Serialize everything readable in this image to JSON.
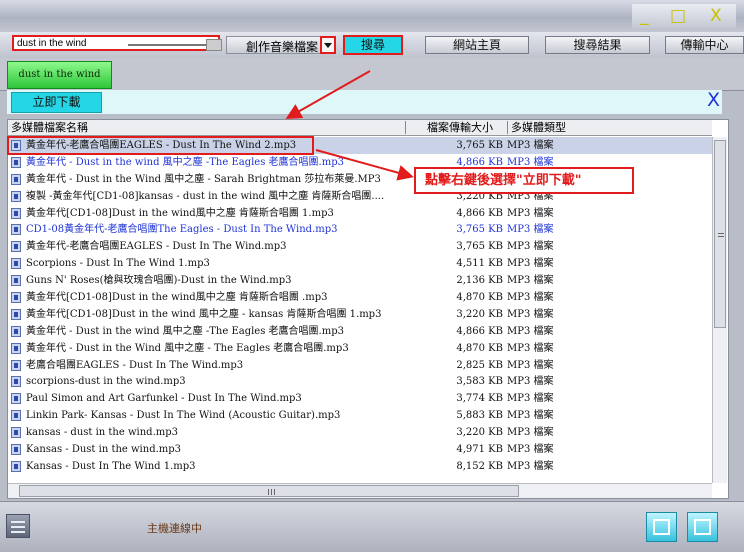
{
  "window": {
    "buttons": [
      "_",
      "□",
      "X"
    ]
  },
  "toolbar": {
    "search_value": "dust in the wind",
    "category": "創作音樂檔案",
    "search_label": "搜尋",
    "home_label": "網站主頁",
    "results_label": "搜尋結果",
    "transfer_label": "傳輸中心"
  },
  "tab_label": "dust in the wind",
  "download_label": "立即下載",
  "close_label": "X",
  "columns": {
    "name": "多媒體檔案名稱",
    "size": "檔案傳輸大小",
    "type": "多媒體類型"
  },
  "rows": [
    {
      "name": "黃金年代-老鷹合唱團EAGLES - Dust In The Wind 2.mp3",
      "size": "3,765 KB",
      "type": "MP3 檔案",
      "selected": true
    },
    {
      "name": "黃金年代 - Dust in the wind 風中之塵 -The Eagles 老鷹合唱團.mp3",
      "size": "4,866 KB",
      "type": "MP3 檔案",
      "blue": true
    },
    {
      "name": "黃金年代 - Dust in the Wind 風中之塵 - Sarah Brightman 莎拉布萊曼.MP3",
      "size": "4,868 KB",
      "type": "MP3 檔案"
    },
    {
      "name": "複製 -黃金年代[CD1-08]kansas - dust in the wind 風中之塵 肯薩斯合唱團....",
      "size": "3,220 KB",
      "type": "MP3 檔案"
    },
    {
      "name": "黃金年代[CD1-08]Dust in the wind風中之塵 肯薩斯合唱團 1.mp3",
      "size": "4,866 KB",
      "type": "MP3 檔案"
    },
    {
      "name": "CD1-08黃金年代-老鷹合唱團The Eagles - Dust In The Wind.mp3",
      "size": "3,765 KB",
      "type": "MP3 檔案",
      "blue": true
    },
    {
      "name": "黃金年代-老鷹合唱團EAGLES - Dust In The Wind.mp3",
      "size": "3,765 KB",
      "type": "MP3 檔案"
    },
    {
      "name": "Scorpions - Dust In The Wind 1.mp3",
      "size": "4,511 KB",
      "type": "MP3 檔案"
    },
    {
      "name": "Guns N' Roses(槍與玫瑰合唱團)-Dust in the Wind.mp3",
      "size": "2,136 KB",
      "type": "MP3 檔案"
    },
    {
      "name": "黃金年代[CD1-08]Dust in the wind風中之塵 肯薩斯合唱團 .mp3",
      "size": "4,870 KB",
      "type": "MP3 檔案"
    },
    {
      "name": "黃金年代[CD1-08]Dust in the wind 風中之塵 - kansas 肯薩斯合唱團 1.mp3",
      "size": "3,220 KB",
      "type": "MP3 檔案"
    },
    {
      "name": "黃金年代 - Dust in the wind 風中之塵 -The Eagles 老鷹合唱團.mp3",
      "size": "4,866 KB",
      "type": "MP3 檔案"
    },
    {
      "name": "黃金年代 - Dust in the Wind 風中之塵 - The Eagles 老鷹合唱團.mp3",
      "size": "4,870 KB",
      "type": "MP3 檔案"
    },
    {
      "name": "老鷹合唱團EAGLES - Dust In The Wind.mp3",
      "size": "2,825 KB",
      "type": "MP3 檔案"
    },
    {
      "name": "scorpions-dust in the wind.mp3",
      "size": "3,583 KB",
      "type": "MP3 檔案"
    },
    {
      "name": "Paul Simon and Art Garfunkel - Dust In The Wind.mp3",
      "size": "3,774 KB",
      "type": "MP3 檔案"
    },
    {
      "name": "Linkin Park- Kansas - Dust In The Wind (Acoustic Guitar).mp3",
      "size": "5,883 KB",
      "type": "MP3 檔案"
    },
    {
      "name": "kansas - dust in the wind.mp3",
      "size": "3,220 KB",
      "type": "MP3 檔案"
    },
    {
      "name": "Kansas - Dust in the wind.mp3",
      "size": "4,971 KB",
      "type": "MP3 檔案"
    },
    {
      "name": "Kansas - Dust In The Wind 1.mp3",
      "size": "8,152 KB",
      "type": "MP3 檔案"
    }
  ],
  "annotation": "點擊右鍵後選擇\"立即下載\"",
  "status_text": "主機連線中"
}
